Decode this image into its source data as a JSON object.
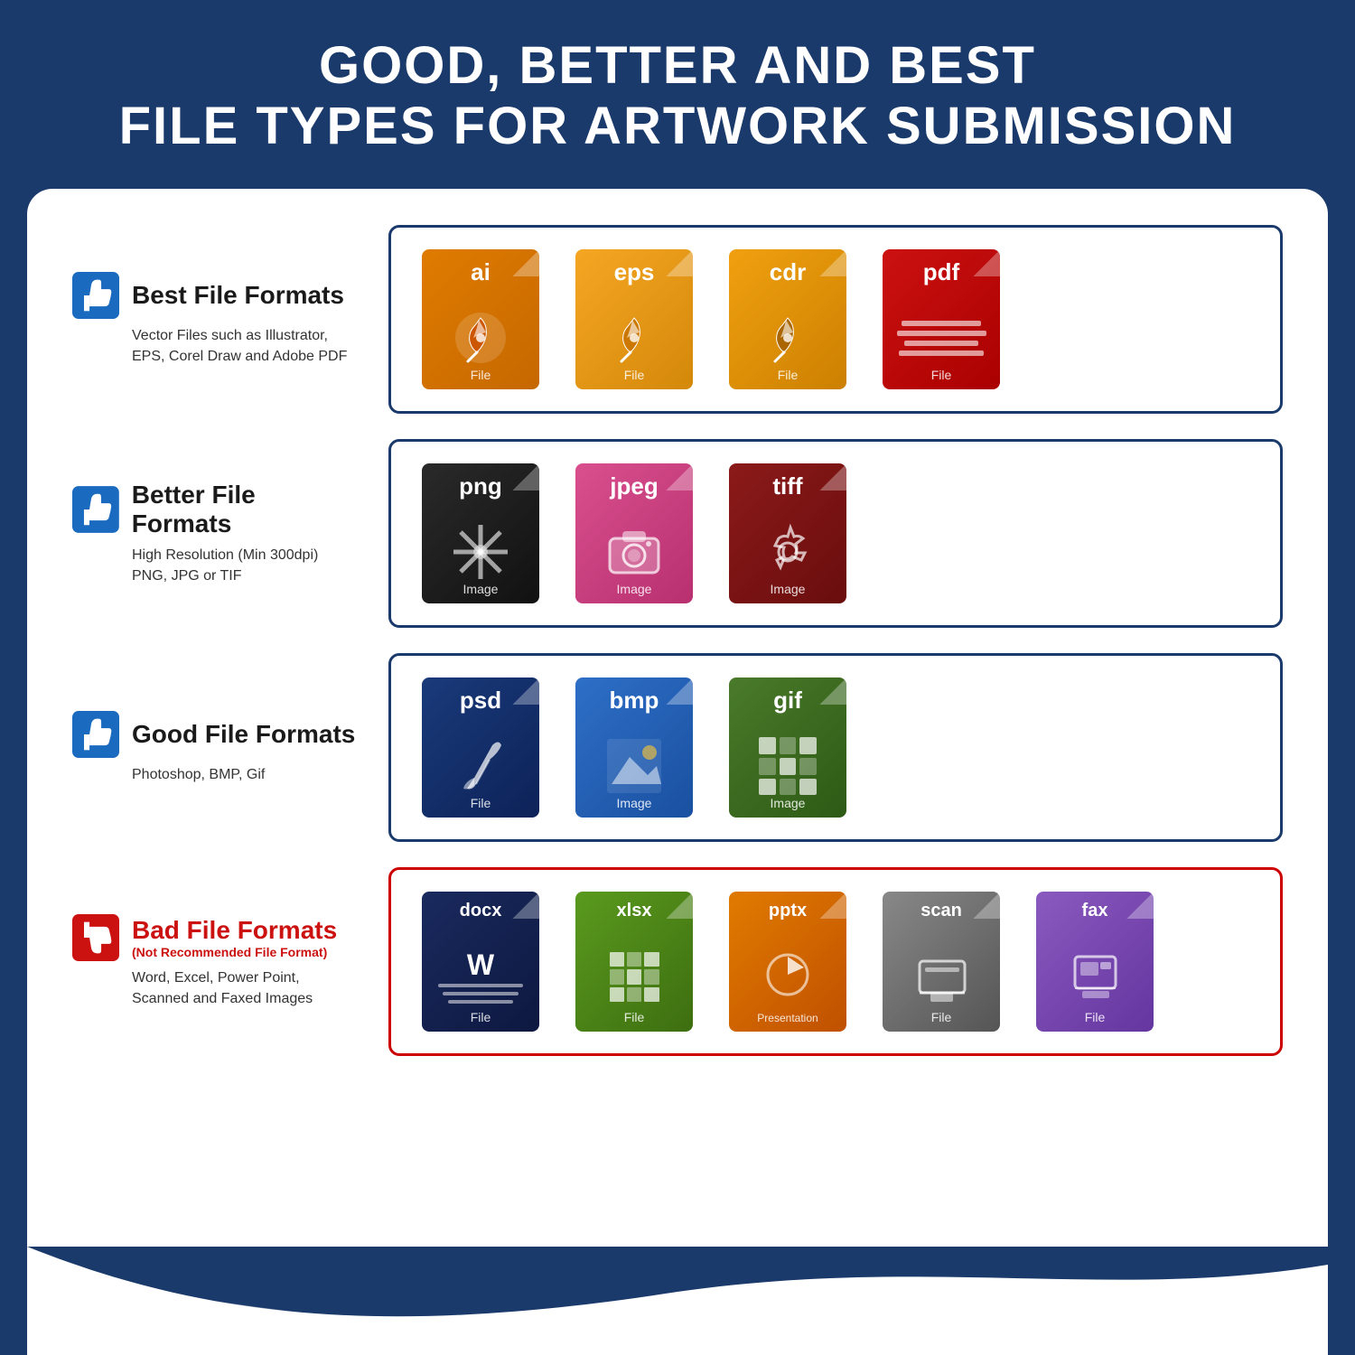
{
  "header": {
    "line1": "GOOD, BETTER AND BEST",
    "line2": "FILE TYPES FOR ARTWORK SUBMISSION"
  },
  "rows": [
    {
      "id": "best",
      "thumbs": "up",
      "title": "Best File Formats",
      "subtitle": "",
      "description": "Vector Files such as Illustrator,\nEPS, Corel Draw and Adobe PDF",
      "border": "blue",
      "files": [
        {
          "ext": "ai",
          "color": "orange",
          "label": "File",
          "icon": "pen"
        },
        {
          "ext": "EPS",
          "color": "orange-light",
          "label": "File",
          "icon": "pen"
        },
        {
          "ext": "cdr",
          "color": "orange-light",
          "label": "File",
          "icon": "pen"
        },
        {
          "ext": "Pdf",
          "color": "red-file",
          "label": "File",
          "icon": "doc"
        }
      ]
    },
    {
      "id": "better",
      "thumbs": "up",
      "title": "Better File Formats",
      "subtitle": "",
      "description": "High Resolution (Min 300dpi)\nPNG, JPG or TIF",
      "border": "blue",
      "files": [
        {
          "ext": "png",
          "color": "dark-gray",
          "label": "Image",
          "icon": "snowflake"
        },
        {
          "ext": "Jpeg",
          "color": "pink",
          "label": "Image",
          "icon": "camera"
        },
        {
          "ext": "tiff",
          "color": "dark-red",
          "label": "Image",
          "icon": "gear"
        }
      ]
    },
    {
      "id": "good",
      "thumbs": "up",
      "title": "Good File Formats",
      "subtitle": "",
      "description": "Photoshop, BMP, Gif",
      "border": "blue",
      "files": [
        {
          "ext": "Psd",
          "color": "navy",
          "label": "File",
          "icon": "brush"
        },
        {
          "ext": "Bmp",
          "color": "blue-med",
          "label": "Image",
          "icon": "mountain"
        },
        {
          "ext": "Gif",
          "color": "green-file",
          "label": "Image",
          "icon": "gif-grid"
        }
      ]
    },
    {
      "id": "bad",
      "thumbs": "down",
      "title": "Bad File Formats",
      "subtitle": "(Not Recommended File Format)",
      "description": "Word, Excel, Power Point,\nScanned and Faxed Images",
      "border": "red",
      "files": [
        {
          "ext": "docx",
          "color": "blue-dark",
          "label": "File",
          "icon": "word"
        },
        {
          "ext": "xlsx",
          "color": "green-bright",
          "label": "File",
          "icon": "excel"
        },
        {
          "ext": "pptx",
          "color": "orange-ppt",
          "label": "Presentation",
          "icon": "ppt"
        },
        {
          "ext": "scan",
          "color": "gray-file",
          "label": "File",
          "icon": "scan"
        },
        {
          "ext": "fax",
          "color": "purple-file",
          "label": "File",
          "icon": "fax"
        }
      ]
    }
  ]
}
